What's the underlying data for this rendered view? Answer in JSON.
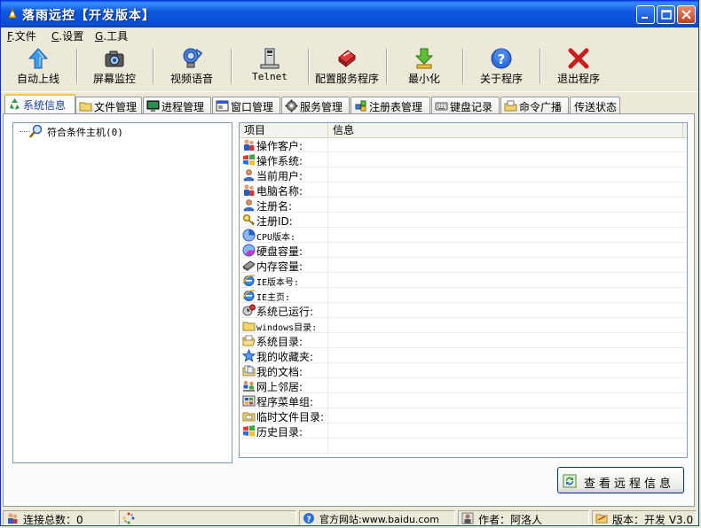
{
  "window": {
    "title": "落雨远控【开发版本】"
  },
  "menu": [
    {
      "key": "F",
      "label": ".文件"
    },
    {
      "key": "C",
      "label": ".设置"
    },
    {
      "key": "G",
      "label": ".工具"
    }
  ],
  "toolbar": [
    {
      "label": "自动上线",
      "icon": "arrow-up-icon"
    },
    {
      "label": "屏幕监控",
      "icon": "camera-icon"
    },
    {
      "label": "视频语音",
      "icon": "webcam-icon"
    },
    {
      "label": "Telnet",
      "icon": "terminal-computer-icon"
    },
    {
      "label": "配置服务程序",
      "icon": "config-icon"
    },
    {
      "label": "最小化",
      "icon": "minimize-arrow-icon"
    },
    {
      "label": "关于程序",
      "icon": "help-icon"
    },
    {
      "label": "退出程序",
      "icon": "exit-x-icon"
    }
  ],
  "tabs": [
    {
      "label": "系统信息",
      "icon": "recycle-icon",
      "active": true
    },
    {
      "label": "文件管理",
      "icon": "folder-icon"
    },
    {
      "label": "进程管理",
      "icon": "monitor-icon"
    },
    {
      "label": "窗口管理",
      "icon": "window-icon"
    },
    {
      "label": "服务管理",
      "icon": "gear-icon"
    },
    {
      "label": "注册表管理",
      "icon": "registry-icon"
    },
    {
      "label": "键盘记录",
      "icon": "keyboard-icon"
    },
    {
      "label": "命令广播",
      "icon": "broadcast-icon"
    },
    {
      "label": "传送状态",
      "icon": ""
    }
  ],
  "tree": {
    "root_label": "符合条件主机(0)"
  },
  "listview": {
    "columns": [
      "项目",
      "信息"
    ],
    "rows": [
      {
        "label": "操作客户:",
        "icon": "users-icon"
      },
      {
        "label": "操作系统:",
        "icon": "windows-logo-icon"
      },
      {
        "label": "当前用户:",
        "icon": "user-icon"
      },
      {
        "label": "电脑名称:",
        "icon": "users-icon"
      },
      {
        "label": "注册名:",
        "icon": "user-icon"
      },
      {
        "label": "注册ID:",
        "icon": "key-icon"
      },
      {
        "label": "CPU版本:",
        "icon": "cpu-pie-icon"
      },
      {
        "label": "硬盘容量:",
        "icon": "disk-pie-icon"
      },
      {
        "label": "内存容量:",
        "icon": "memory-icon"
      },
      {
        "label": "IE版本号:",
        "icon": "ie-icon"
      },
      {
        "label": "IE主页:",
        "icon": "ie-icon"
      },
      {
        "label": "系统已运行:",
        "icon": "clock-gear-icon"
      },
      {
        "label": "windows目录:",
        "icon": "folder-icon"
      },
      {
        "label": "系统目录:",
        "icon": "folder-open-icon"
      },
      {
        "label": "我的收藏夹:",
        "icon": "star-icon"
      },
      {
        "label": "我的文档:",
        "icon": "documents-icon"
      },
      {
        "label": "网上邻居:",
        "icon": "network-icon"
      },
      {
        "label": "程序菜单组:",
        "icon": "programs-icon"
      },
      {
        "label": "临时文件目录:",
        "icon": "temp-folder-icon"
      },
      {
        "label": "历史目录:",
        "icon": "windows-logo-icon"
      }
    ]
  },
  "view_button": {
    "label": "查看远程信息"
  },
  "status": [
    {
      "label": "连接总数：0",
      "icon": "users-icon"
    },
    {
      "label": "",
      "icon": "spinner-icon"
    },
    {
      "label": "官方网站:www.baidu.com",
      "icon": "help-icon"
    },
    {
      "label": "作者：阿洛人",
      "icon": "user-icon"
    },
    {
      "label": "版本：开发 V3.0",
      "icon": "info-icon"
    }
  ]
}
